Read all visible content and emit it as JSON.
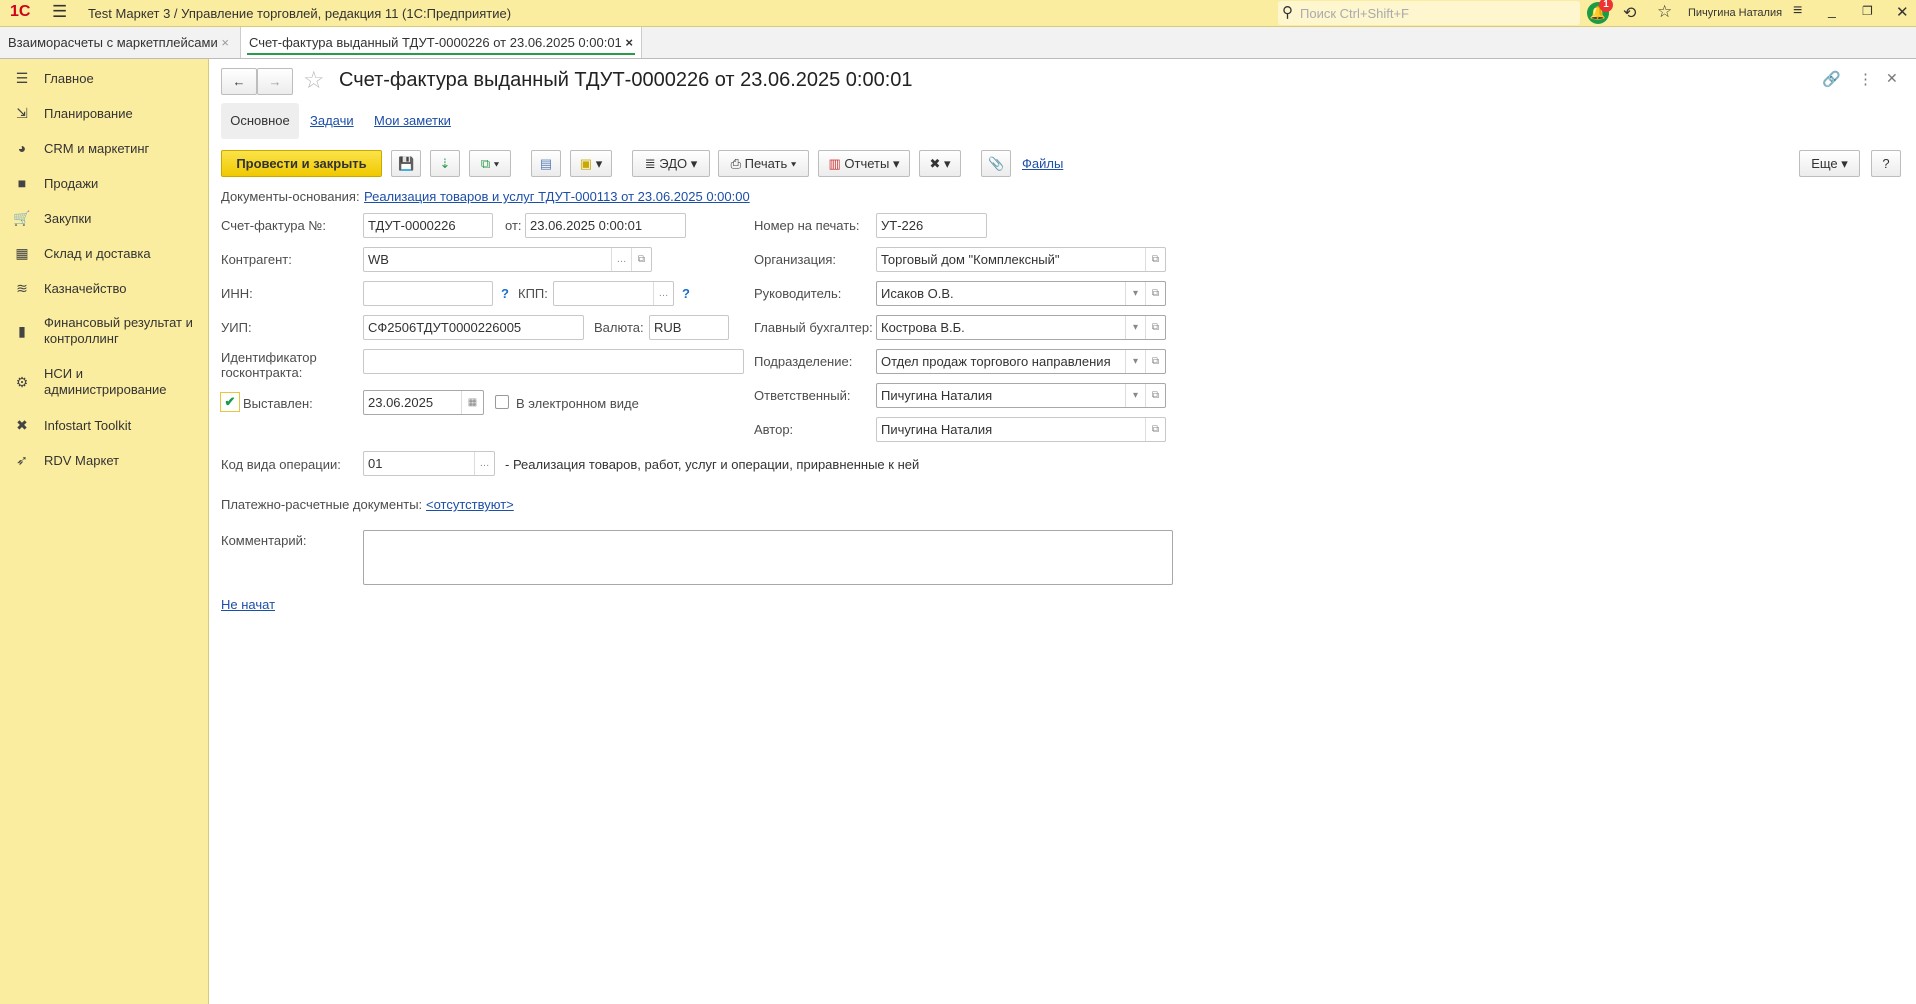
{
  "titlebar": {
    "title": "Test Маркет 3 / Управление торговлей, редакция 11  (1С:Предприятие)",
    "search_placeholder": "Поиск Ctrl+Shift+F",
    "notifications": "1",
    "user": "Пичугина Наталия"
  },
  "tabs": [
    {
      "label": "Взаиморасчеты с маркетплейсами"
    },
    {
      "label": "Счет-фактура выданный ТДУТ-0000226 от 23.06.2025 0:00:01"
    }
  ],
  "sidebar": {
    "items": [
      {
        "label": "Главное"
      },
      {
        "label": "Планирование"
      },
      {
        "label": "CRM и маркетинг"
      },
      {
        "label": "Продажи"
      },
      {
        "label": "Закупки"
      },
      {
        "label": "Склад и доставка"
      },
      {
        "label": "Казначейство"
      },
      {
        "label": "Финансовый результат и контроллинг"
      },
      {
        "label": "НСИ и администрирование"
      },
      {
        "label": "Infostart Toolkit"
      },
      {
        "label": "RDV Маркет"
      }
    ]
  },
  "form": {
    "title": "Счет-фактура выданный ТДУТ-0000226 от 23.06.2025 0:00:01",
    "subtabs": [
      "Основное",
      "Задачи",
      "Мои заметки"
    ],
    "toolbar": {
      "post_close": "Провести и закрыть",
      "edo": "ЭДО",
      "print": "Печать",
      "reports": "Отчеты",
      "files": "Файлы",
      "more": "Еще",
      "help": "?"
    },
    "basis_label": "Документы-основания:",
    "basis_link": "Реализация товаров и услуг ТДУТ-000113 от 23.06.2025 0:00:00",
    "invoice_no_label": "Счет-фактура №:",
    "invoice_no": "ТДУТ-0000226",
    "from_label": "от:",
    "date": "23.06.2025  0:00:01",
    "counterparty_label": "Контрагент:",
    "counterparty": "WB",
    "inn_label": "ИНН:",
    "inn": "",
    "kpp_label": "КПП:",
    "kpp": "",
    "help_mark": "?",
    "uip_label": "УИП:",
    "uip": "СФ2506ТДУТ0000226005",
    "currency_label": "Валюта:",
    "currency": "RUB",
    "gov_id_label": "Идентификатор госконтракта:",
    "gov_id": "",
    "issued_label": "Выставлен:",
    "issued_checked": true,
    "issued_date": "23.06.2025",
    "electronic_label": "В электронном виде",
    "electronic_checked": false,
    "print_no_label": "Номер на печать:",
    "print_no": "УТ-226",
    "org_label": "Организация:",
    "org": "Торговый дом \"Комплексный\"",
    "head_label": "Руководитель:",
    "head": "Исаков О.В.",
    "accountant_label": "Главный бухгалтер:",
    "accountant": "Кострова В.Б.",
    "dept_label": "Подразделение:",
    "dept": "Отдел продаж торгового направления",
    "responsible_label": "Ответственный:",
    "responsible": "Пичугина Наталия",
    "author_label": "Автор:",
    "author": "Пичугина Наталия",
    "op_code_label": "Код вида операции:",
    "op_code": "01",
    "op_code_desc": "- Реализация товаров, работ, услуг и операции, приравненные к ней",
    "payment_docs_label": "Платежно-расчетные документы:",
    "payment_docs_link": "<отсутствуют>",
    "comment_label": "Комментарий:",
    "comment": "",
    "status_link": "Не начат"
  }
}
